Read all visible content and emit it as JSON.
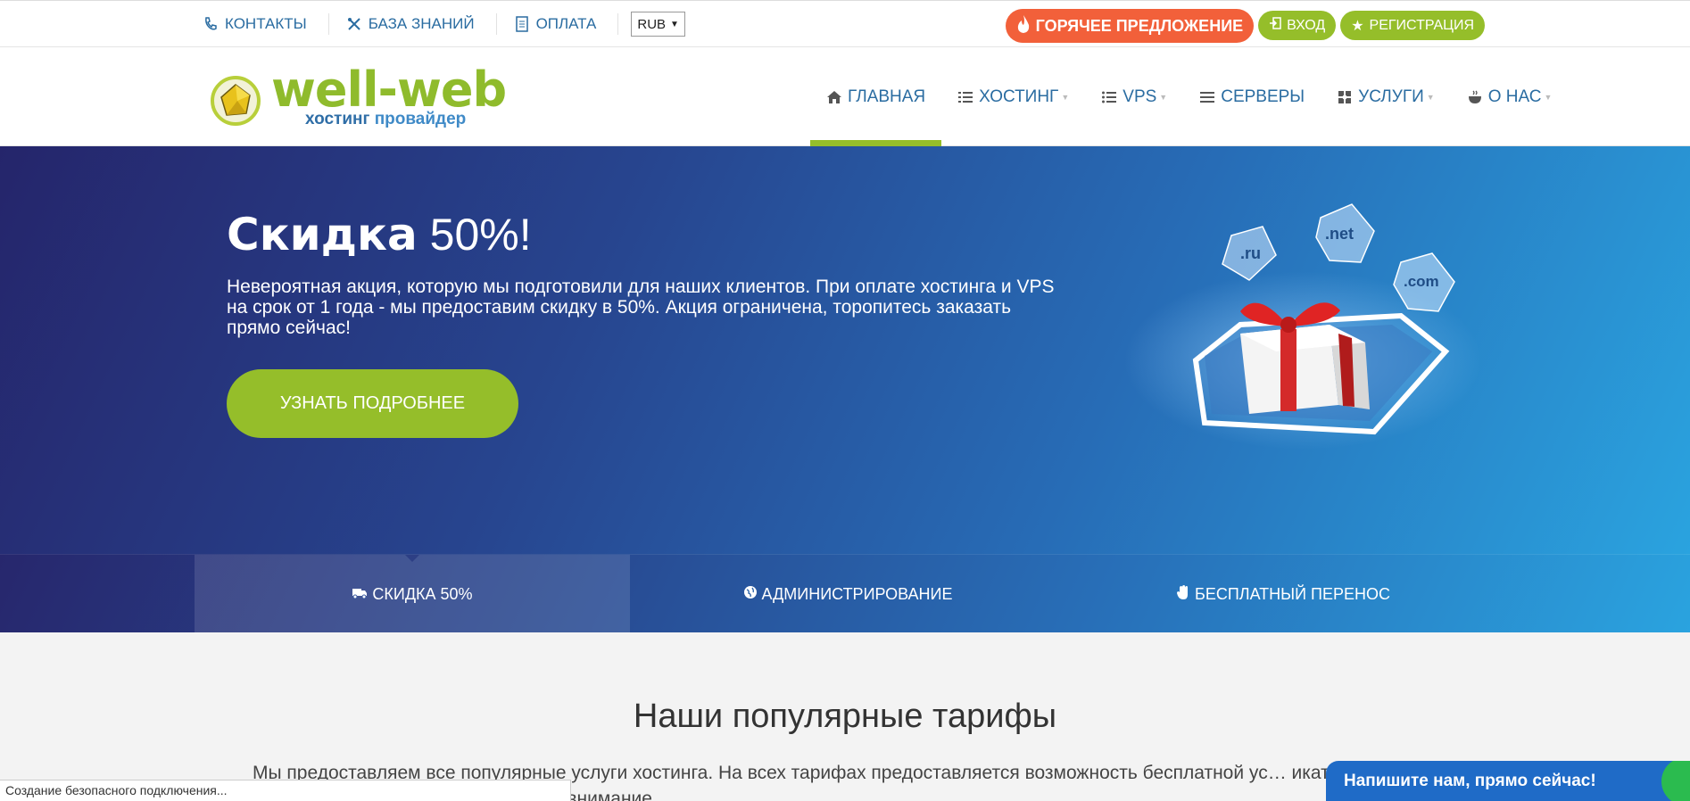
{
  "topbar": {
    "links": [
      {
        "label": "Контакты",
        "icon": "phone-icon"
      },
      {
        "label": "База знаний",
        "icon": "tools-icon"
      },
      {
        "label": "Оплата",
        "icon": "document-icon"
      }
    ],
    "currency": "RUB",
    "hot_offer": "ГОРЯЧЕЕ ПРЕДЛОЖЕНИЕ",
    "login": "Вход",
    "register": "Регистрация"
  },
  "logo": {
    "name": "well-web",
    "sub_1": "хостинг",
    "sub_2": "провайдер"
  },
  "nav": {
    "items": [
      {
        "label": "Главная",
        "icon": "home-icon",
        "dropdown": false
      },
      {
        "label": "Хостинг",
        "icon": "list-icon",
        "dropdown": true
      },
      {
        "label": "VPS",
        "icon": "list-icon",
        "dropdown": true
      },
      {
        "label": "Серверы",
        "icon": "bars-icon",
        "dropdown": false
      },
      {
        "label": "Услуги",
        "icon": "puzzle-icon",
        "dropdown": true
      },
      {
        "label": "О нас",
        "icon": "coffee-icon",
        "dropdown": true
      }
    ],
    "active_index": 0
  },
  "hero": {
    "title_bold": "Скидка",
    "title_light": "50%!",
    "text": "Невероятная акция, которую мы подготовили для наших клиентов. При оплате хостинга и VPS на срок от 1 года - мы предоставим скидку в 50%. Акция ограничена, торопитесь заказать прямо сейчас!",
    "button": "Узнать подробнее",
    "domains": [
      ".ru",
      ".net",
      ".com"
    ]
  },
  "tabs": [
    {
      "label": "Скидка 50%",
      "icon": "truck-icon"
    },
    {
      "label": "Администрирование",
      "icon": "globe-icon"
    },
    {
      "label": "Бесплатный перенос",
      "icon": "hand-icon"
    }
  ],
  "section": {
    "title": "Наши популярные тарифы",
    "text": "Мы предоставляем все популярные услуги хостинга. На всех тарифах предоставляется возможность бесплатной ус… икатов. Тарифы на которые мы рекомендуем обратить внимание"
  },
  "status_bar": "Создание безопасного подключения...",
  "chat": "Напишите нам, прямо сейчас!",
  "colors": {
    "brand_green": "#95be2a",
    "brand_blue": "#2a6ca1",
    "hot_orange": "#f2603a",
    "chat_blue": "#1f6bc7"
  }
}
